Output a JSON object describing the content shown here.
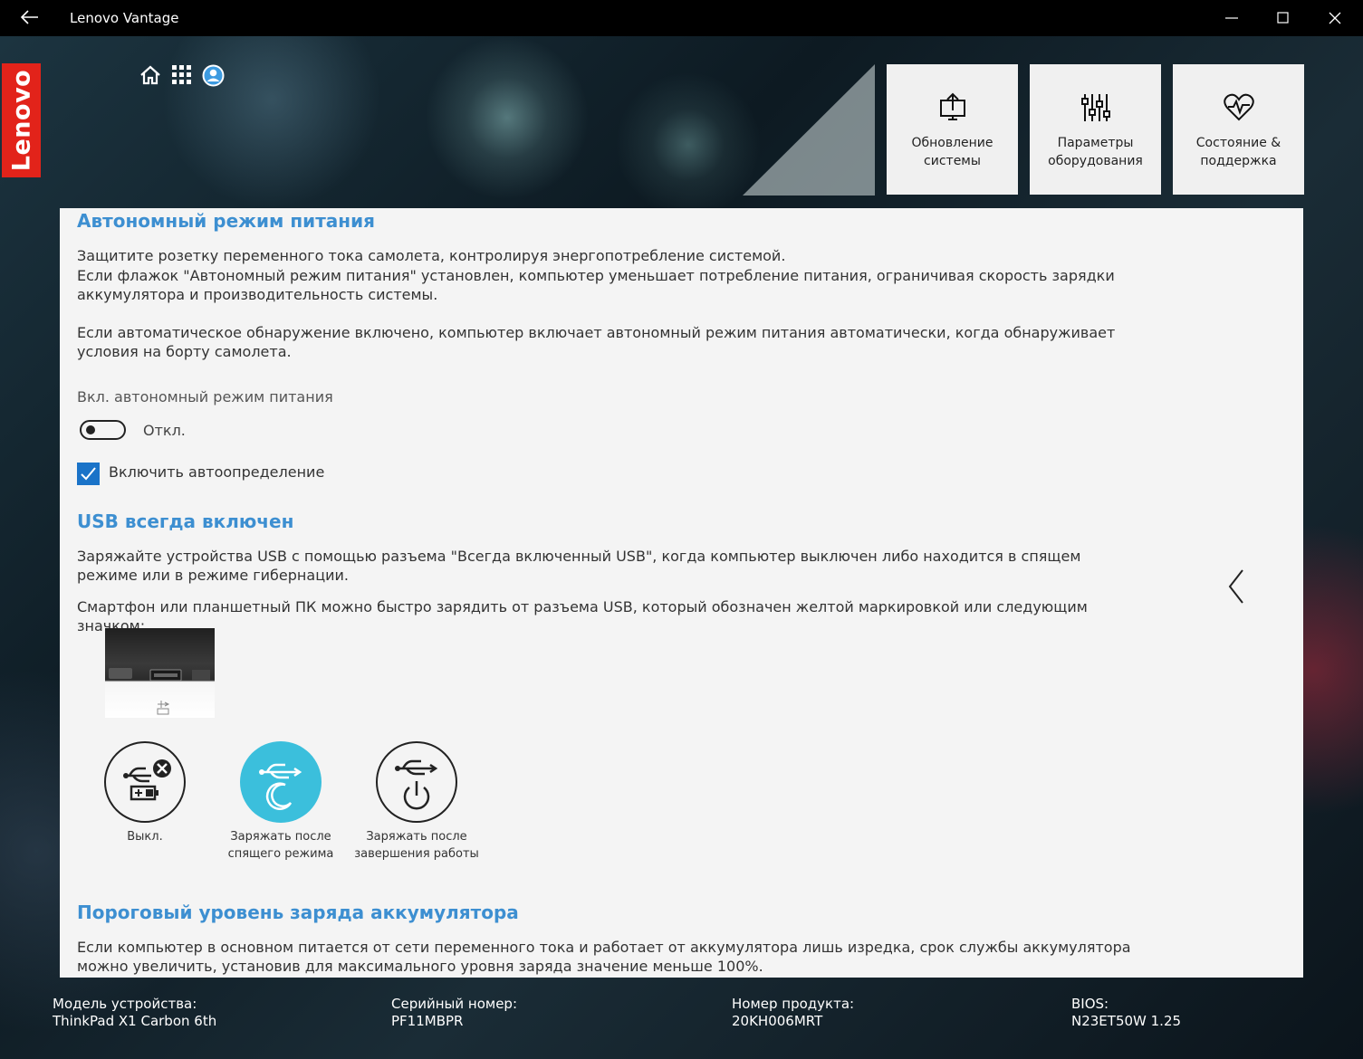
{
  "window": {
    "title": "Lenovo Vantage"
  },
  "brand": {
    "logo_text": "Lenovo",
    "logo_color": "#e2231a",
    "accent_color": "#3d8fd1"
  },
  "top_icons": [
    "home-icon",
    "apps-grid-icon",
    "account-icon"
  ],
  "nav_tiles": [
    {
      "label": "Обновление системы",
      "icon": "system-update-icon"
    },
    {
      "label": "Параметры оборудования",
      "icon": "hardware-settings-icon"
    },
    {
      "label": "Состояние & поддержка",
      "icon": "health-support-icon"
    }
  ],
  "airplane": {
    "title": "Автономный режим питания",
    "desc1": "Защитите розетку переменного тока самолета, контролируя энергопотребление системой.",
    "desc2": "Если флажок \"Автономный режим питания\" установлен, компьютер уменьшает потребление питания, ограничивая скорость зарядки аккумулятора и производительность системы.",
    "desc3": "Если автоматическое обнаружение включено, компьютер включает автономный режим питания автоматически, когда обнаруживает условия на борту самолета.",
    "toggle_label": "Вкл. автономный режим питания",
    "toggle_state": "Откл.",
    "toggle_on": false,
    "checkbox_label": "Включить автоопределение",
    "checkbox_checked": true
  },
  "usb": {
    "title": "USB всегда включен",
    "desc1": "Заряжайте устройства USB с помощью разъема \"Всегда включенный USB\", когда компьютер выключен либо находится в спящем режиме или в режиме гибернации.",
    "desc2": "Смартфон или планшетный ПК можно быстро зарядить от разъема USB, который обозначен желтой маркировкой или следующим значком:",
    "options": [
      {
        "label": "Выкл.",
        "icon": "usb-off-icon",
        "selected": false
      },
      {
        "label": "Заряжать после спящего режима",
        "icon": "usb-sleep-charge-icon",
        "selected": true
      },
      {
        "label": "Заряжать после завершения работы",
        "icon": "usb-shutdown-charge-icon",
        "selected": false
      }
    ],
    "selected_color": "#3bbfdc"
  },
  "threshold": {
    "title": "Пороговый уровень заряда аккумулятора",
    "desc1": "Если компьютер в основном питается от сети переменного тока и работает от аккумулятора лишь изредка, срок службы аккумулятора можно увеличить, установив для максимального уровня заряда значение меньше 100%."
  },
  "footer": {
    "model_label": "Модель устройства:",
    "model_value": "ThinkPad X1 Carbon 6th",
    "serial_label": "Серийный номер:",
    "serial_value": "PF11MBPR",
    "product_label": "Номер продукта:",
    "product_value": "20KH006MRT",
    "bios_label": "BIOS:",
    "bios_value": "N23ET50W 1.25"
  }
}
